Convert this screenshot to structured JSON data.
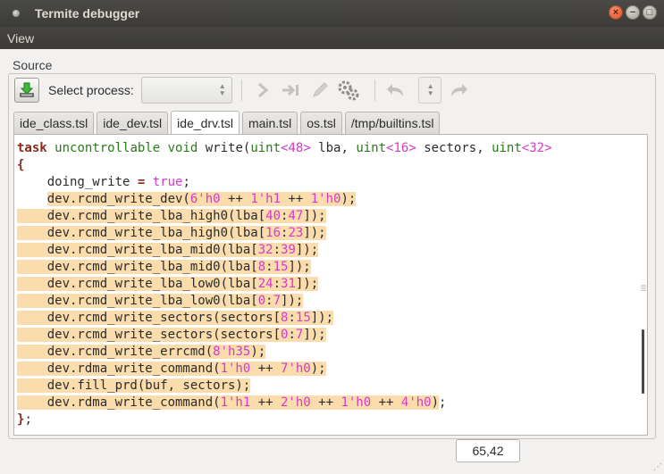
{
  "window": {
    "title": "Termite debugger"
  },
  "menu": {
    "items": [
      "View"
    ]
  },
  "source": {
    "label": "Source",
    "select_process_label": "Select process:",
    "select_process_value": ""
  },
  "toolbar": {
    "icons": [
      "download-icon",
      "continue-icon",
      "step-icon",
      "edit-icon",
      "settings-icon",
      "undo-icon",
      "redo-icon"
    ]
  },
  "tabs": [
    {
      "label": "ide_class.tsl",
      "active": false
    },
    {
      "label": "ide_dev.tsl",
      "active": false
    },
    {
      "label": "ide_drv.tsl",
      "active": true
    },
    {
      "label": "main.tsl",
      "active": false
    },
    {
      "label": "os.tsl",
      "active": false
    },
    {
      "label": "/tmp/builtins.tsl",
      "active": false
    }
  ],
  "code": {
    "lines": [
      [
        [
          "kw",
          "task "
        ],
        [
          "ty",
          "uncontrollable void "
        ],
        [
          "txt",
          "write("
        ],
        [
          "ty",
          "uint"
        ],
        [
          "num",
          "<48>"
        ],
        [
          "txt",
          " lba, "
        ],
        [
          "ty",
          "uint"
        ],
        [
          "num",
          "<16>"
        ],
        [
          "txt",
          " sectors, "
        ],
        [
          "ty",
          "uint"
        ],
        [
          "num",
          "<32>"
        ]
      ],
      [
        [
          "kw",
          "{"
        ]
      ],
      [
        [
          "txt",
          "    doing_write "
        ],
        [
          "kw",
          "="
        ],
        [
          "txt",
          " "
        ],
        [
          "num",
          "true"
        ],
        [
          "txt",
          ";"
        ]
      ],
      [
        [
          "txt",
          "    "
        ],
        [
          "hl",
          [
            [
              "txt",
              "dev.rcmd_write_dev("
            ],
            [
              "num",
              "6'h0"
            ],
            [
              "txt",
              " ++ "
            ],
            [
              "num",
              "1'h1"
            ],
            [
              "txt",
              " ++ "
            ],
            [
              "num",
              "1'h0"
            ],
            [
              "txt",
              ");"
            ]
          ]
        ]
      ],
      [
        [
          "hl",
          [
            [
              "txt",
              "    dev.rcmd_write_lba_high0(lba["
            ],
            [
              "num",
              "40"
            ],
            [
              "txt",
              ":"
            ],
            [
              "num",
              "47"
            ],
            [
              "txt",
              "]);"
            ]
          ]
        ]
      ],
      [
        [
          "hl",
          [
            [
              "txt",
              "    dev.rcmd_write_lba_high0(lba["
            ],
            [
              "num",
              "16"
            ],
            [
              "txt",
              ":"
            ],
            [
              "num",
              "23"
            ],
            [
              "txt",
              "]);"
            ]
          ]
        ]
      ],
      [
        [
          "hl",
          [
            [
              "txt",
              "    dev.rcmd_write_lba_mid0(lba["
            ],
            [
              "num",
              "32"
            ],
            [
              "txt",
              ":"
            ],
            [
              "num",
              "39"
            ],
            [
              "txt",
              "]);"
            ]
          ]
        ]
      ],
      [
        [
          "hl",
          [
            [
              "txt",
              "    dev.rcmd_write_lba_mid0(lba["
            ],
            [
              "num",
              "8"
            ],
            [
              "txt",
              ":"
            ],
            [
              "num",
              "15"
            ],
            [
              "txt",
              "]);"
            ]
          ]
        ]
      ],
      [
        [
          "hl",
          [
            [
              "txt",
              "    dev.rcmd_write_lba_low0(lba["
            ],
            [
              "num",
              "24"
            ],
            [
              "txt",
              ":"
            ],
            [
              "num",
              "31"
            ],
            [
              "txt",
              "]);"
            ]
          ]
        ]
      ],
      [
        [
          "hl",
          [
            [
              "txt",
              "    dev.rcmd_write_lba_low0(lba["
            ],
            [
              "num",
              "0"
            ],
            [
              "txt",
              ":"
            ],
            [
              "num",
              "7"
            ],
            [
              "txt",
              "]);"
            ]
          ]
        ]
      ],
      [
        [
          "hl",
          [
            [
              "txt",
              "    dev.rcmd_write_sectors(sectors["
            ],
            [
              "num",
              "8"
            ],
            [
              "txt",
              ":"
            ],
            [
              "num",
              "15"
            ],
            [
              "txt",
              "]);"
            ]
          ]
        ]
      ],
      [
        [
          "hl",
          [
            [
              "txt",
              "    dev.rcmd_write_sectors(sectors["
            ],
            [
              "num",
              "0"
            ],
            [
              "txt",
              ":"
            ],
            [
              "num",
              "7"
            ],
            [
              "txt",
              "]);"
            ]
          ]
        ]
      ],
      [
        [
          "hl",
          [
            [
              "txt",
              "    dev.rcmd_write_errcmd("
            ],
            [
              "num",
              "8'h35"
            ],
            [
              "txt",
              ");"
            ]
          ]
        ]
      ],
      [
        [
          "hl",
          [
            [
              "txt",
              "    dev.rdma_write_command("
            ],
            [
              "num",
              "1'h0"
            ],
            [
              "txt",
              " ++ "
            ],
            [
              "num",
              "7'h0"
            ],
            [
              "txt",
              ");"
            ]
          ]
        ]
      ],
      [
        [
          "hl",
          [
            [
              "txt",
              "    dev.fill_prd(buf, sectors);"
            ]
          ]
        ]
      ],
      [
        [
          "hl",
          [
            [
              "txt",
              "    dev.rdma_write_command("
            ],
            [
              "num",
              "1'h1"
            ],
            [
              "txt",
              " ++ "
            ],
            [
              "num",
              "2'h0"
            ],
            [
              "txt",
              " ++ "
            ],
            [
              "num",
              "1'h0"
            ],
            [
              "txt",
              " ++ "
            ],
            [
              "num",
              "4'h0"
            ],
            [
              "txt",
              ")"
            ]
          ]
        ],
        [
          "txt",
          ";"
        ]
      ],
      [
        [
          "kw",
          "}"
        ],
        [
          "txt",
          ";"
        ]
      ]
    ]
  },
  "status": {
    "cursor_position": "65,42"
  },
  "colors": {
    "highlight": "#fbdcad",
    "keyword": "#8a2a1a",
    "type": "#2a7a1a",
    "number": "#d33bc8"
  }
}
